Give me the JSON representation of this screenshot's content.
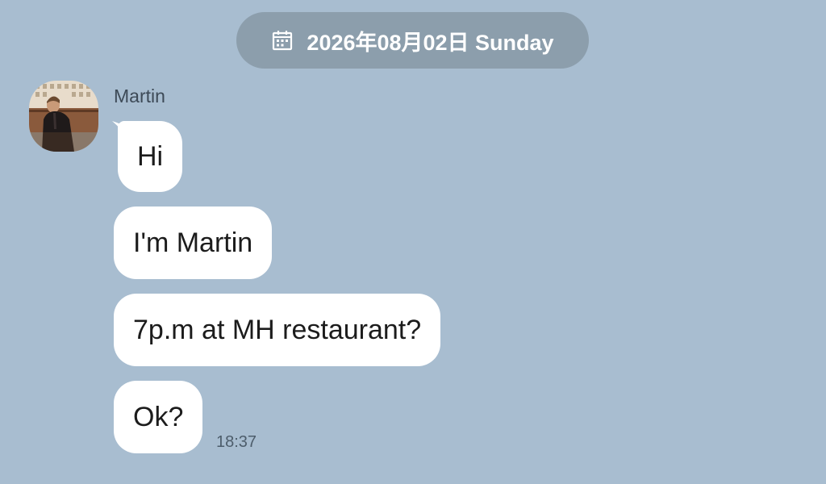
{
  "date_header": {
    "icon": "calendar-icon",
    "label": "2026年08月02日 Sunday"
  },
  "conversation": {
    "sender": {
      "name": "Martin",
      "avatar": "avatar-photo"
    },
    "messages": [
      {
        "text": "Hi"
      },
      {
        "text": "I'm Martin"
      },
      {
        "text": "7p.m at MH restaurant?"
      },
      {
        "text": "Ok?",
        "time": "18:37"
      }
    ]
  },
  "colors": {
    "background": "#a8bdd0",
    "date_pill": "#8c9eac",
    "bubble": "#ffffff"
  }
}
